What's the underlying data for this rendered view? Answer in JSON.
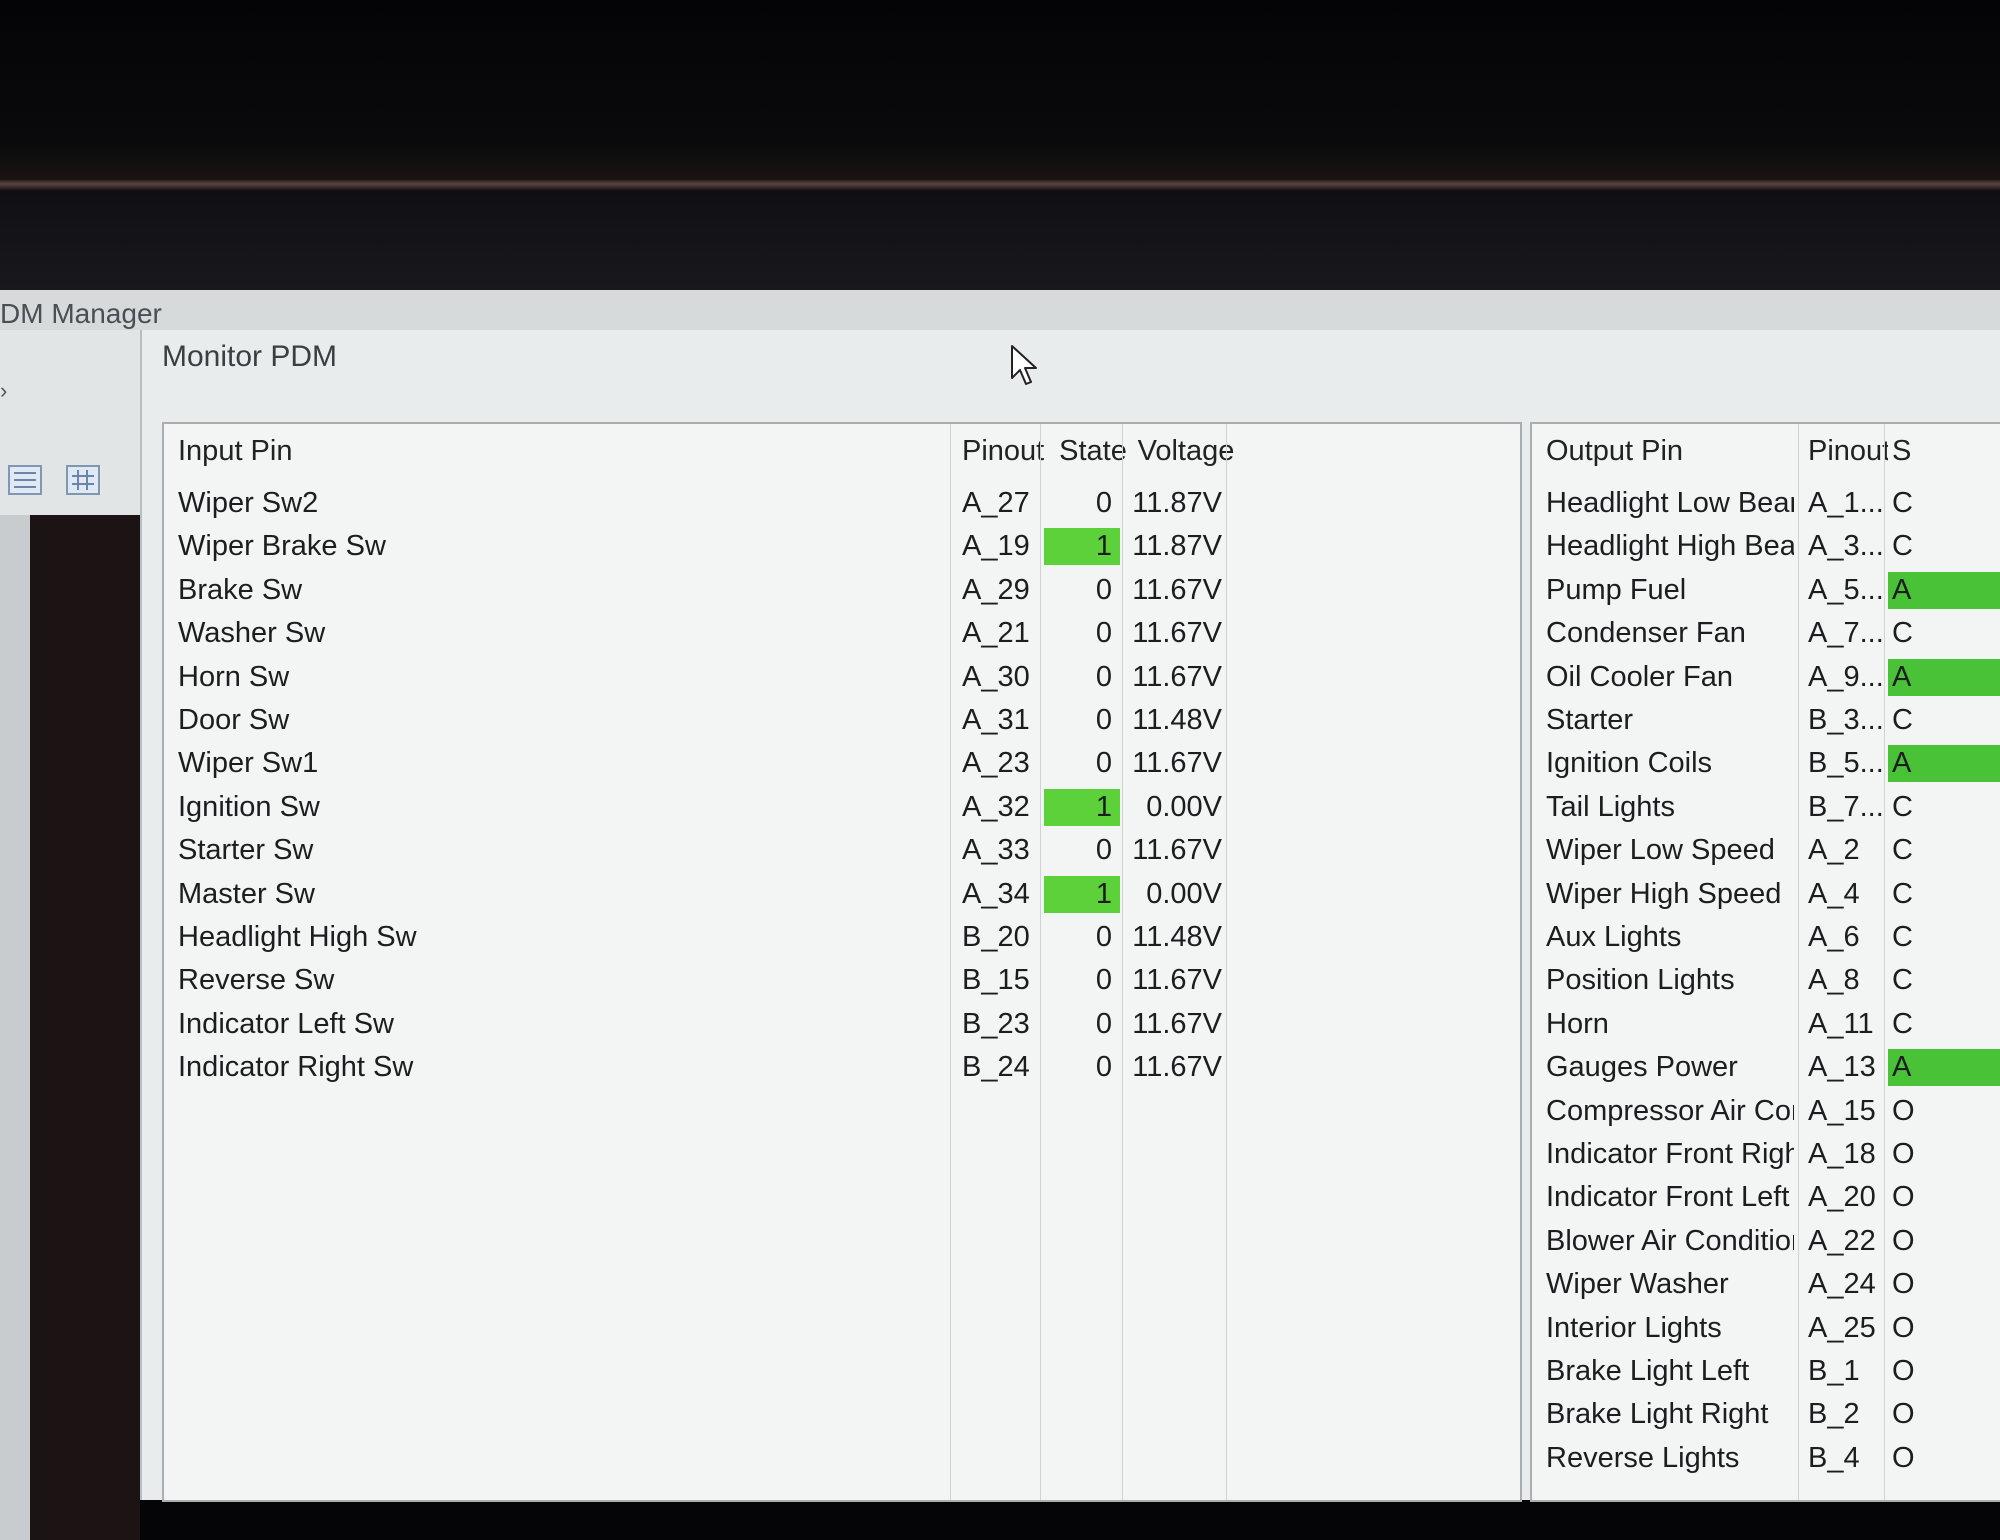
{
  "app": {
    "title": "DM Manager",
    "chevron": "›"
  },
  "dialog": {
    "title": "Monitor PDM"
  },
  "icons": {
    "list_view": "list-view-icon",
    "grid_view": "grid-view-icon",
    "cursor": "mouse-pointer-icon"
  },
  "colors": {
    "state_active": "#5cd13a"
  },
  "input_table": {
    "headers": {
      "pin": "Input Pin",
      "pinout": "Pinout",
      "state": "State",
      "voltage": "Voltage"
    },
    "rows": [
      {
        "pin": "Wiper Sw2",
        "pinout": "A_27",
        "state": "0",
        "voltage": "11.87V",
        "active": false
      },
      {
        "pin": "Wiper Brake Sw",
        "pinout": "A_19",
        "state": "1",
        "voltage": "11.87V",
        "active": true
      },
      {
        "pin": "Brake Sw",
        "pinout": "A_29",
        "state": "0",
        "voltage": "11.67V",
        "active": false
      },
      {
        "pin": "Washer Sw",
        "pinout": "A_21",
        "state": "0",
        "voltage": "11.67V",
        "active": false
      },
      {
        "pin": "Horn Sw",
        "pinout": "A_30",
        "state": "0",
        "voltage": "11.67V",
        "active": false
      },
      {
        "pin": "Door Sw",
        "pinout": "A_31",
        "state": "0",
        "voltage": "11.48V",
        "active": false
      },
      {
        "pin": "Wiper Sw1",
        "pinout": "A_23",
        "state": "0",
        "voltage": "11.67V",
        "active": false
      },
      {
        "pin": "Ignition Sw",
        "pinout": "A_32",
        "state": "1",
        "voltage": "0.00V",
        "active": true
      },
      {
        "pin": "Starter Sw",
        "pinout": "A_33",
        "state": "0",
        "voltage": "11.67V",
        "active": false
      },
      {
        "pin": "Master Sw",
        "pinout": "A_34",
        "state": "1",
        "voltage": "0.00V",
        "active": true
      },
      {
        "pin": "Headlight High Sw",
        "pinout": "B_20",
        "state": "0",
        "voltage": "11.48V",
        "active": false
      },
      {
        "pin": "Reverse Sw",
        "pinout": "B_15",
        "state": "0",
        "voltage": "11.67V",
        "active": false
      },
      {
        "pin": "Indicator Left Sw",
        "pinout": "B_23",
        "state": "0",
        "voltage": "11.67V",
        "active": false
      },
      {
        "pin": "Indicator Right Sw",
        "pinout": "B_24",
        "state": "0",
        "voltage": "11.67V",
        "active": false
      }
    ]
  },
  "output_table": {
    "headers": {
      "pin": "Output Pin",
      "pinout": "Pinout",
      "state": "S"
    },
    "rows": [
      {
        "pin": "Headlight Low Beam",
        "pinout": "A_1...",
        "state": "C",
        "active": false
      },
      {
        "pin": "Headlight High Beam",
        "pinout": "A_3...",
        "state": "C",
        "active": false
      },
      {
        "pin": "Pump Fuel",
        "pinout": "A_5...",
        "state": "A",
        "active": true
      },
      {
        "pin": "Condenser Fan",
        "pinout": "A_7...",
        "state": "C",
        "active": false
      },
      {
        "pin": "Oil Cooler Fan",
        "pinout": "A_9...",
        "state": "A",
        "active": true
      },
      {
        "pin": "Starter",
        "pinout": "B_3...",
        "state": "C",
        "active": false
      },
      {
        "pin": "Ignition Coils",
        "pinout": "B_5...",
        "state": "A",
        "active": true
      },
      {
        "pin": "Tail Lights",
        "pinout": "B_7...",
        "state": "C",
        "active": false
      },
      {
        "pin": "Wiper Low Speed",
        "pinout": "A_2",
        "state": "C",
        "active": false
      },
      {
        "pin": "Wiper High Speed",
        "pinout": "A_4",
        "state": "C",
        "active": false
      },
      {
        "pin": "Aux Lights",
        "pinout": "A_6",
        "state": "C",
        "active": false
      },
      {
        "pin": "Position Lights",
        "pinout": "A_8",
        "state": "C",
        "active": false
      },
      {
        "pin": "Horn",
        "pinout": "A_11",
        "state": "C",
        "active": false
      },
      {
        "pin": "Gauges Power",
        "pinout": "A_13",
        "state": "A",
        "active": true
      },
      {
        "pin": "Compressor Air Conditio...",
        "pinout": "A_15",
        "state": "O",
        "active": false
      },
      {
        "pin": "Indicator Front Right",
        "pinout": "A_18",
        "state": "O",
        "active": false
      },
      {
        "pin": "Indicator Front Left",
        "pinout": "A_20",
        "state": "O",
        "active": false
      },
      {
        "pin": "Blower Air Conditioner",
        "pinout": "A_22",
        "state": "O",
        "active": false
      },
      {
        "pin": "Wiper Washer",
        "pinout": "A_24",
        "state": "O",
        "active": false
      },
      {
        "pin": "Interior Lights",
        "pinout": "A_25",
        "state": "O",
        "active": false
      },
      {
        "pin": "Brake Light Left",
        "pinout": "B_1",
        "state": "O",
        "active": false
      },
      {
        "pin": "Brake Light Right",
        "pinout": "B_2",
        "state": "O",
        "active": false
      },
      {
        "pin": "Reverse Lights",
        "pinout": "B_4",
        "state": "O",
        "active": false
      }
    ]
  }
}
